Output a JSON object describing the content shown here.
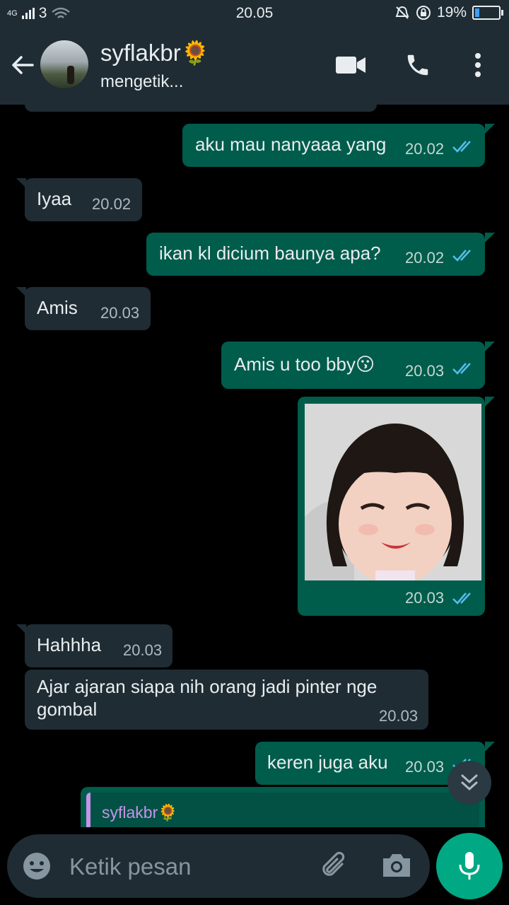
{
  "statusbar": {
    "network": "4G",
    "signal_label": "3",
    "time": "20.05",
    "battery": "19%",
    "battery_level": 0.19
  },
  "header": {
    "contact_name": "syflakbr🌻",
    "status": "mengetik..."
  },
  "messages": [
    {
      "dir": "in",
      "text": "",
      "time": ""
    },
    {
      "dir": "out",
      "text": "aku mau nanyaaa yang",
      "time": "20.02",
      "read": true
    },
    {
      "dir": "in",
      "text": "Iyaa",
      "time": "20.02"
    },
    {
      "dir": "out",
      "text": "ikan kl dicium baunya apa?",
      "time": "20.02",
      "read": true
    },
    {
      "dir": "in",
      "text": "Amis",
      "time": "20.03"
    },
    {
      "dir": "out",
      "text": "Amis u too bby😗",
      "time": "20.03",
      "read": true
    },
    {
      "dir": "out",
      "type": "image",
      "time": "20.03",
      "read": true
    },
    {
      "dir": "in",
      "text": "Hahhha",
      "time": "20.03"
    },
    {
      "dir": "in",
      "text": "Ajar ajaran siapa nih orang jadi pinter nge gombal",
      "time": "20.03"
    },
    {
      "dir": "out",
      "text": "keren juga aku",
      "time": "20.03",
      "read": true
    },
    {
      "dir": "out",
      "type": "reply",
      "quoted_name": "syflakbr🌻"
    }
  ],
  "composer": {
    "placeholder": "Ketik pesan"
  },
  "colors": {
    "bar_bg": "#1f2c34",
    "incoming": "#1f2c34",
    "outgoing": "#005c4b",
    "accent": "#00a884",
    "read_ticks": "#53bdeb",
    "reply_name": "#c792e9"
  },
  "icons": [
    "back-arrow-icon",
    "video-call-icon",
    "phone-icon",
    "more-vert-icon",
    "double-check-icon",
    "chevrons-down-icon",
    "emoji-icon",
    "attach-icon",
    "camera-icon",
    "mic-icon"
  ]
}
